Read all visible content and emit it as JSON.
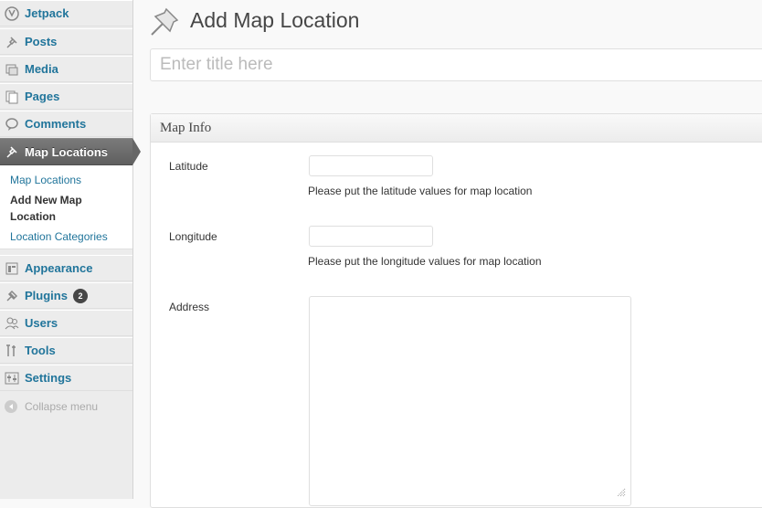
{
  "sidebar": {
    "items": [
      {
        "label": "Jetpack",
        "icon": "jetpack-icon"
      },
      {
        "label": "Posts",
        "icon": "pin-icon"
      },
      {
        "label": "Media",
        "icon": "media-icon"
      },
      {
        "label": "Pages",
        "icon": "pages-icon"
      },
      {
        "label": "Comments",
        "icon": "comments-icon"
      },
      {
        "label": "Map Locations",
        "icon": "pin-icon",
        "active": true
      },
      {
        "label": "Appearance",
        "icon": "appearance-icon"
      },
      {
        "label": "Plugins",
        "icon": "plugins-icon",
        "badge": "2"
      },
      {
        "label": "Users",
        "icon": "users-icon"
      },
      {
        "label": "Tools",
        "icon": "tools-icon"
      },
      {
        "label": "Settings",
        "icon": "settings-icon"
      }
    ],
    "submenu": [
      {
        "label": "Map Locations"
      },
      {
        "label": "Add New Map Location",
        "current": true
      },
      {
        "label": "Location Categories"
      }
    ],
    "collapse_label": "Collapse menu"
  },
  "main": {
    "page_title": "Add Map Location",
    "title_placeholder": "Enter title here",
    "metabox": {
      "title": "Map Info",
      "latitude_label": "Latitude",
      "latitude_help": "Please put the latitude values for map location",
      "longitude_label": "Longitude",
      "longitude_help": "Please put the longitude values for map location",
      "address_label": "Address"
    }
  },
  "colors": {
    "link": "#21759b",
    "active_bg": "#6d6d6d",
    "sidebar_bg": "#ececec"
  }
}
